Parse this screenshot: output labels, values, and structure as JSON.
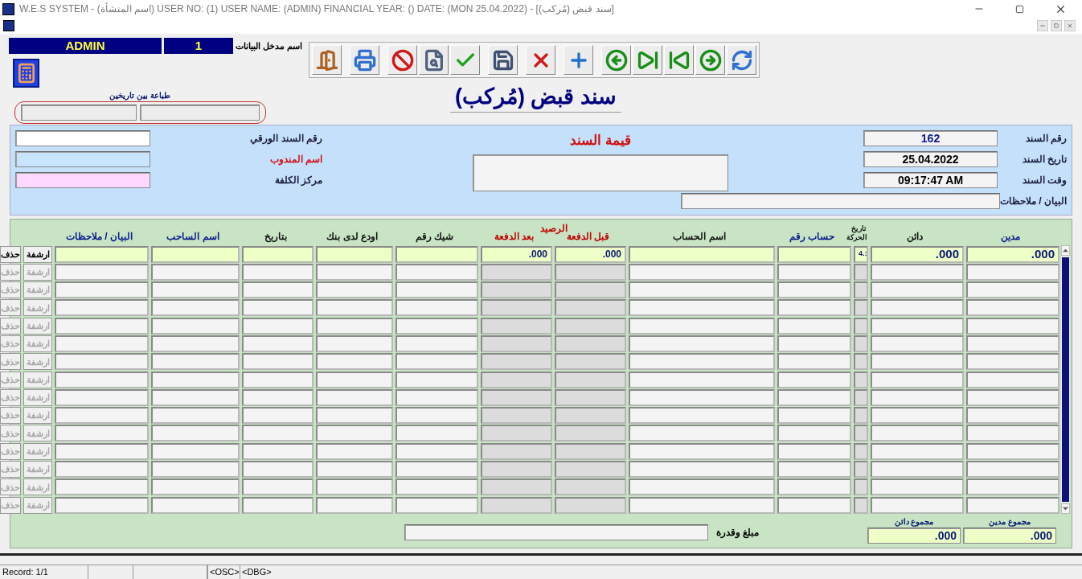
{
  "window": {
    "title": "W.E.S SYSTEM -  (اسم المنشأة)  USER NO: (1) USER NAME: (ADMIN) FINANCIAL YEAR: ()  DATE: (MON 25.04.2022) - [سند قبض (مُركب)]"
  },
  "user": {
    "name": "ADMIN",
    "number": "1",
    "label": "اسم مدخل البيانات"
  },
  "print_between_dates": {
    "label": "طباعة بين تاريخين"
  },
  "form_title": "سند قبض (مُركب)",
  "header_fields": {
    "voucher_no": {
      "label": "رقم السند",
      "value": "162"
    },
    "voucher_date": {
      "label": "تاريخ السند",
      "value": "25.04.2022"
    },
    "voucher_time": {
      "label": "وقت السند",
      "value": "09:17:47 AM"
    },
    "notes": {
      "label": "البيان / ملاحظات"
    },
    "voucher_amount": {
      "label": "قيمة السند"
    },
    "paper_voucher_no": {
      "label": "رقم السند الورقي"
    },
    "representative": {
      "label": "اسم المندوب"
    },
    "cost_center": {
      "label": "مركز الكلفة"
    }
  },
  "grid": {
    "columns": [
      {
        "header": "مدين",
        "color": "#0a1a8a"
      },
      {
        "header": "دائن",
        "color": "#111111"
      },
      {
        "header": "تاريخ الحركة",
        "color": "#111111"
      },
      {
        "header": "حساب رقم",
        "color": "#0a1a8a"
      },
      {
        "header": "اسم الحساب",
        "color": "#111111"
      },
      {
        "header": "قبل الدفعة",
        "color": "#c00000"
      },
      {
        "header": "بعد الدفعة",
        "color": "#c00000"
      },
      {
        "header": "شيك رقم",
        "color": "#111111"
      },
      {
        "header": "اودع لدى بنك",
        "color": "#111111"
      },
      {
        "header": "بتاريخ",
        "color": "#111111"
      },
      {
        "header": "اسم الساحب",
        "color": "#0a1a8a"
      },
      {
        "header": "البيان / ملاحظات",
        "color": "#0a1a8a"
      }
    ],
    "group_header": "الرصيد",
    "rows": [
      {
        "selected": true,
        "disabled": false,
        "archive": "ارشفة",
        "delete": "حذف",
        "debit": ".000",
        "credit": ".000",
        "movement_date": "4.:",
        "before_payment": ".000",
        "after_payment": ".000"
      },
      {
        "selected": false,
        "disabled": true,
        "archive": "ارشفة",
        "delete": "حذف"
      },
      {
        "selected": false,
        "disabled": true,
        "archive": "ارشفة",
        "delete": "حذف"
      },
      {
        "selected": false,
        "disabled": true,
        "archive": "ارشفة",
        "delete": "حذف"
      },
      {
        "selected": false,
        "disabled": true,
        "archive": "ارشفة",
        "delete": "حذف"
      },
      {
        "selected": false,
        "disabled": true,
        "archive": "ارشفة",
        "delete": "حذف"
      },
      {
        "selected": false,
        "disabled": true,
        "archive": "ارشفة",
        "delete": "حذف"
      },
      {
        "selected": false,
        "disabled": true,
        "archive": "ارشفة",
        "delete": "حذف"
      },
      {
        "selected": false,
        "disabled": true,
        "archive": "ارشفة",
        "delete": "حذف"
      },
      {
        "selected": false,
        "disabled": true,
        "archive": "ارشفة",
        "delete": "حذف"
      },
      {
        "selected": false,
        "disabled": true,
        "archive": "ارشفة",
        "delete": "حذف"
      },
      {
        "selected": false,
        "disabled": true,
        "archive": "ارشفة",
        "delete": "حذف"
      },
      {
        "selected": false,
        "disabled": true,
        "archive": "ارشفة",
        "delete": "حذف"
      },
      {
        "selected": false,
        "disabled": true,
        "archive": "ارشفة",
        "delete": "حذف"
      },
      {
        "selected": false,
        "disabled": true,
        "archive": "ارشفة",
        "delete": "حذف"
      }
    ]
  },
  "totals": {
    "debit": {
      "label": "مجموع مدين",
      "value": ".000"
    },
    "credit": {
      "label": "مجموع دائن",
      "value": ".000"
    },
    "amount_in_words": {
      "label": "مبلغ وقدرة"
    }
  },
  "status_bar": {
    "record": "Record: 1/1",
    "panes": [
      "<DBG>",
      "<OSC>"
    ]
  }
}
